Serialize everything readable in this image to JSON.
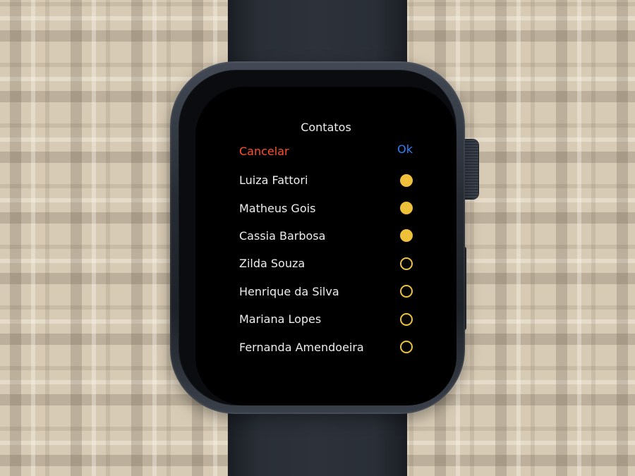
{
  "screen": {
    "title": "Contatos",
    "cancel_label": "Cancelar",
    "ok_label": "Ok"
  },
  "contacts": [
    {
      "name": "Luiza Fattori",
      "selected": true
    },
    {
      "name": "Matheus Gois",
      "selected": true
    },
    {
      "name": "Cassia Barbosa",
      "selected": true
    },
    {
      "name": "Zilda Souza",
      "selected": false
    },
    {
      "name": "Henrique da Silva",
      "selected": false
    },
    {
      "name": "Mariana Lopes",
      "selected": false
    },
    {
      "name": "Fernanda Amendoeira",
      "selected": false
    }
  ],
  "colors": {
    "cancel": "#ff4f2e",
    "ok": "#2f7ff5",
    "selection": "#efc13b",
    "background_pattern": "#d8cbb5"
  }
}
